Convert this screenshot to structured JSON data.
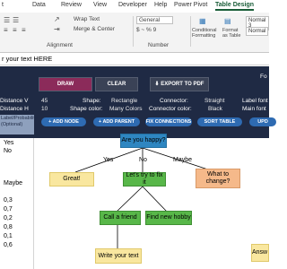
{
  "ribbon": {
    "tabs": [
      "t",
      "Data",
      "Review",
      "View",
      "Developer",
      "Help",
      "Power Pivot",
      "Table Design"
    ],
    "active_tab": "Table Design",
    "groups": {
      "wrap_text": "Wrap Text",
      "merge_center": "Merge & Center",
      "alignment": "Alignment",
      "number": "Number",
      "number_format": "General",
      "currency": "$ ~ % 9",
      "conditional_formatting": "Conditional Formatting",
      "format_as_table": "Format as Table",
      "style_normal3": "Normal 3",
      "style_normal": "Normal"
    }
  },
  "formula_bar": {
    "content": "r your text HERE"
  },
  "controls": {
    "draw_label": "DRAW",
    "clear_label": "CLEAR",
    "export_label": "EXPORT TO PDF",
    "corner_label": "Fo",
    "settings": {
      "distance_v_label": "Distance V",
      "distance_v_value": "45",
      "distance_h_label": "Distance H",
      "distance_h_value": "10",
      "shape_label": "Shape:",
      "shape_value": "Rectangle",
      "shape_color_label": "Shape color:",
      "shape_color_value": "Many Colors",
      "connector_label": "Connector:",
      "connector_value": "Straight",
      "connector_color_label": "Connector color:",
      "connector_color_value": "Black",
      "label_font_label": "Label font",
      "main_font_label": "Main font"
    },
    "actions": {
      "add_node": "+ ADD NODE",
      "add_parent": "+ ADD PARENT",
      "fix_connections": "FIX CONNECTIONS",
      "sort_table": "SORT TABLE",
      "update": "UPD"
    }
  },
  "table": {
    "header": "Label/Probability (Optional)",
    "rows": [
      "Yes",
      "No",
      "",
      "Maybe",
      "",
      "0,3",
      "0,7",
      "0,2",
      "0,8",
      "0,1",
      "0,6"
    ]
  },
  "flowchart": {
    "nodes": {
      "root": "Are you happy?",
      "great": "Great!",
      "try_fix": "Let's try to fix it",
      "what_change": "What to change?",
      "call_friend": "Call a friend",
      "find_hobby": "Find new hobby",
      "write_text": "Write your text",
      "answer": "Answ"
    },
    "edges": {
      "yes": "Yes",
      "no": "No",
      "maybe": "Maybe"
    }
  },
  "colors": {
    "dark_bg": "#1f2a44",
    "draw_btn": "#8b2b5a",
    "accent_blue": "#2e6bb2",
    "node_blue": "#2e86c1",
    "node_yellow": "#f9e79f",
    "node_green": "#58b749",
    "node_orange": "#f5b98a",
    "excel_green": "#185c37"
  }
}
